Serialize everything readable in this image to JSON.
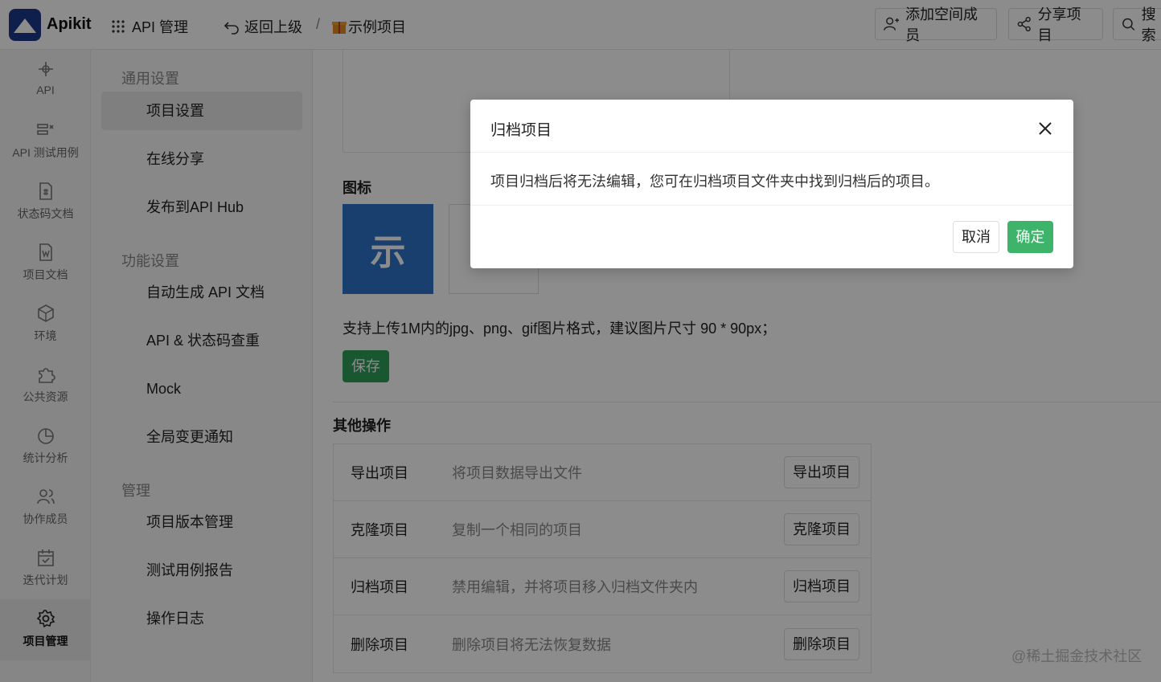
{
  "app": {
    "name": "Apikit",
    "brand_color": "#1d3a8a"
  },
  "header": {
    "api_mgmt_label": "API 管理",
    "back_label": "返回上级",
    "separator": "/",
    "project_name": "示例项目",
    "add_member_label": "添加空间成员",
    "share_label": "分享项目",
    "search_label": "搜索"
  },
  "leftnav": {
    "items": [
      {
        "label": "API",
        "icon": "api-icon"
      },
      {
        "label": "API 测试用例",
        "icon": "test-case-icon"
      },
      {
        "label": "状态码文档",
        "icon": "status-doc-icon"
      },
      {
        "label": "项目文档",
        "icon": "project-doc-icon"
      },
      {
        "label": "环境",
        "icon": "environment-icon"
      },
      {
        "label": "公共资源",
        "icon": "puzzle-icon"
      },
      {
        "label": "统计分析",
        "icon": "pie-chart-icon"
      },
      {
        "label": "协作成员",
        "icon": "members-icon"
      },
      {
        "label": "迭代计划",
        "icon": "calendar-icon"
      },
      {
        "label": "项目管理",
        "icon": "gear-icon"
      }
    ]
  },
  "settings_menu": {
    "group_general": "通用设置",
    "project_settings": "项目设置",
    "online_share": "在线分享",
    "publish_hub": "发布到API Hub",
    "group_features": "功能设置",
    "auto_doc": "自动生成 API 文档",
    "api_check": "API & 状态码查重",
    "mock": "Mock",
    "global_notify": "全局变更通知",
    "group_manage": "管理",
    "version_mgmt": "项目版本管理",
    "test_report": "测试用例报告",
    "op_log": "操作日志"
  },
  "main": {
    "icon_label": "图标",
    "icon_char": "示",
    "icon_color": "#2f74c8",
    "support_text": "支持上传1M内的jpg、png、gif图片格式，建议图片尺寸 90 * 90px；",
    "save_label": "保存",
    "other_title": "其他操作",
    "ops": [
      {
        "name": "导出项目",
        "desc": "将项目数据导出文件",
        "button": "导出项目"
      },
      {
        "name": "克隆项目",
        "desc": "复制一个相同的项目",
        "button": "克隆项目"
      },
      {
        "name": "归档项目",
        "desc": "禁用编辑，并将项目移入归档文件夹内",
        "button": "归档项目"
      },
      {
        "name": "删除项目",
        "desc": "删除项目将无法恢复数据",
        "button": "删除项目"
      }
    ]
  },
  "modal": {
    "title": "归档项目",
    "message": "项目归档后将无法编辑，您可在归档项目文件夹中找到归档后的项目。",
    "cancel_label": "取消",
    "ok_label": "确定",
    "ok_color": "#3eb46a"
  },
  "watermark": "@稀土掘金技术社区"
}
